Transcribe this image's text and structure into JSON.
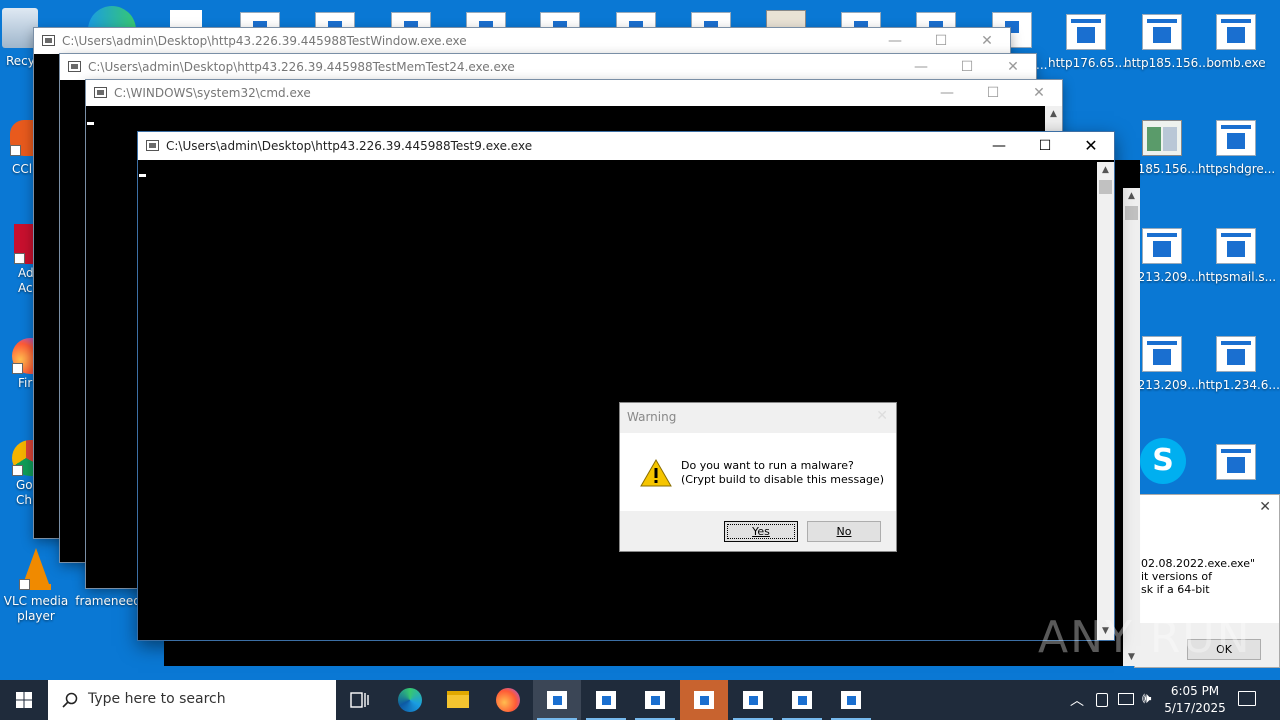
{
  "desktop": {
    "left_icons": [
      {
        "label": "Recy",
        "icon": "recycle-bin-icon"
      },
      {
        "label": "CCl",
        "icon": "ccleaner-icon"
      },
      {
        "label": "Ad\nAcr",
        "icon": "adobe-acrobat-icon"
      },
      {
        "label": "Fir",
        "icon": "firefox-icon"
      },
      {
        "label": "Go\nChr",
        "icon": "chrome-icon"
      },
      {
        "label": "VLC media\nplayer",
        "icon": "vlc-icon"
      },
      {
        "label": "frameneed.",
        "icon": "file-icon"
      }
    ],
    "right_icons_row1": [
      "http176.65....",
      "http185.156...",
      "bomb.exe"
    ],
    "right_icons_row2": [
      "tp185.156...",
      "httpshdgre..."
    ],
    "right_icons_row3": [
      "tp213.209...",
      "httpsmail.s..."
    ],
    "right_icons_row4": [
      "tp213.209...",
      "http1.234.6..."
    ],
    "top_cropped_label": "..."
  },
  "windows": {
    "w1": {
      "title": "C:\\Users\\admin\\Desktop\\http43.226.39.445988TestWindow.exe.exe"
    },
    "w2": {
      "title": "C:\\Users\\admin\\Desktop\\http43.226.39.445988TestMemTest24.exe.exe"
    },
    "w3": {
      "title": "C:\\WINDOWS\\system32\\cmd.exe"
    },
    "w4": {
      "title": "C:\\Users\\admin\\Desktop\\http43.226.39.445988Test9.exe.exe"
    }
  },
  "controls": {
    "minimize": "—",
    "maximize": "☐",
    "close": "✕"
  },
  "dialog": {
    "title": "Warning",
    "line1": "Do you want to run a malware?",
    "line2": "(Crypt build to disable this message)",
    "yes": "Yes",
    "no": "No"
  },
  "bg_message": {
    "line1": "02.08.2022.exe.exe\"",
    "line2": "it versions of",
    "line3": "sk if a 64-bit",
    "ok": "OK"
  },
  "watermark": "ANY RUN",
  "taskbar": {
    "search_placeholder": "Type here to search",
    "time": "6:05 PM",
    "date": "5/17/2025"
  }
}
